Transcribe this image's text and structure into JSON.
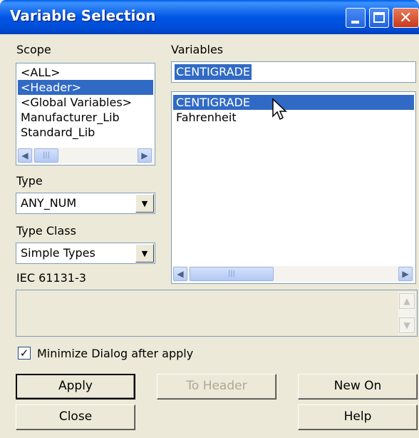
{
  "window": {
    "title": "Variable Selection",
    "controls": {
      "minimize": "minimize-icon",
      "maximize": "maximize-icon",
      "close": "close-icon"
    }
  },
  "scope": {
    "label": "Scope",
    "items": [
      "<ALL>",
      "<Header>",
      "<Global Variables>",
      "Manufacturer_Lib",
      "Standard_Lib"
    ],
    "selected": "<Header>"
  },
  "variables": {
    "label": "Variables",
    "input_value": "CENTIGRADE",
    "items": [
      "CENTIGRADE",
      "Fahrenheit"
    ],
    "selected": "CENTIGRADE"
  },
  "type": {
    "label": "Type",
    "value": "ANY_NUM"
  },
  "type_class": {
    "label": "Type Class",
    "value": "Simple Types"
  },
  "standard": {
    "label": "IEC 61131-3"
  },
  "option": {
    "label": "Minimize  Dialog after apply",
    "checked": true
  },
  "buttons": {
    "apply": "Apply",
    "to_header": "To Header",
    "new_on": "New On",
    "close": "Close",
    "help": "Help"
  },
  "colors": {
    "selection": "#316ac5",
    "titlebar": "#0055e5",
    "dialog_bg": "#ece9d8"
  }
}
